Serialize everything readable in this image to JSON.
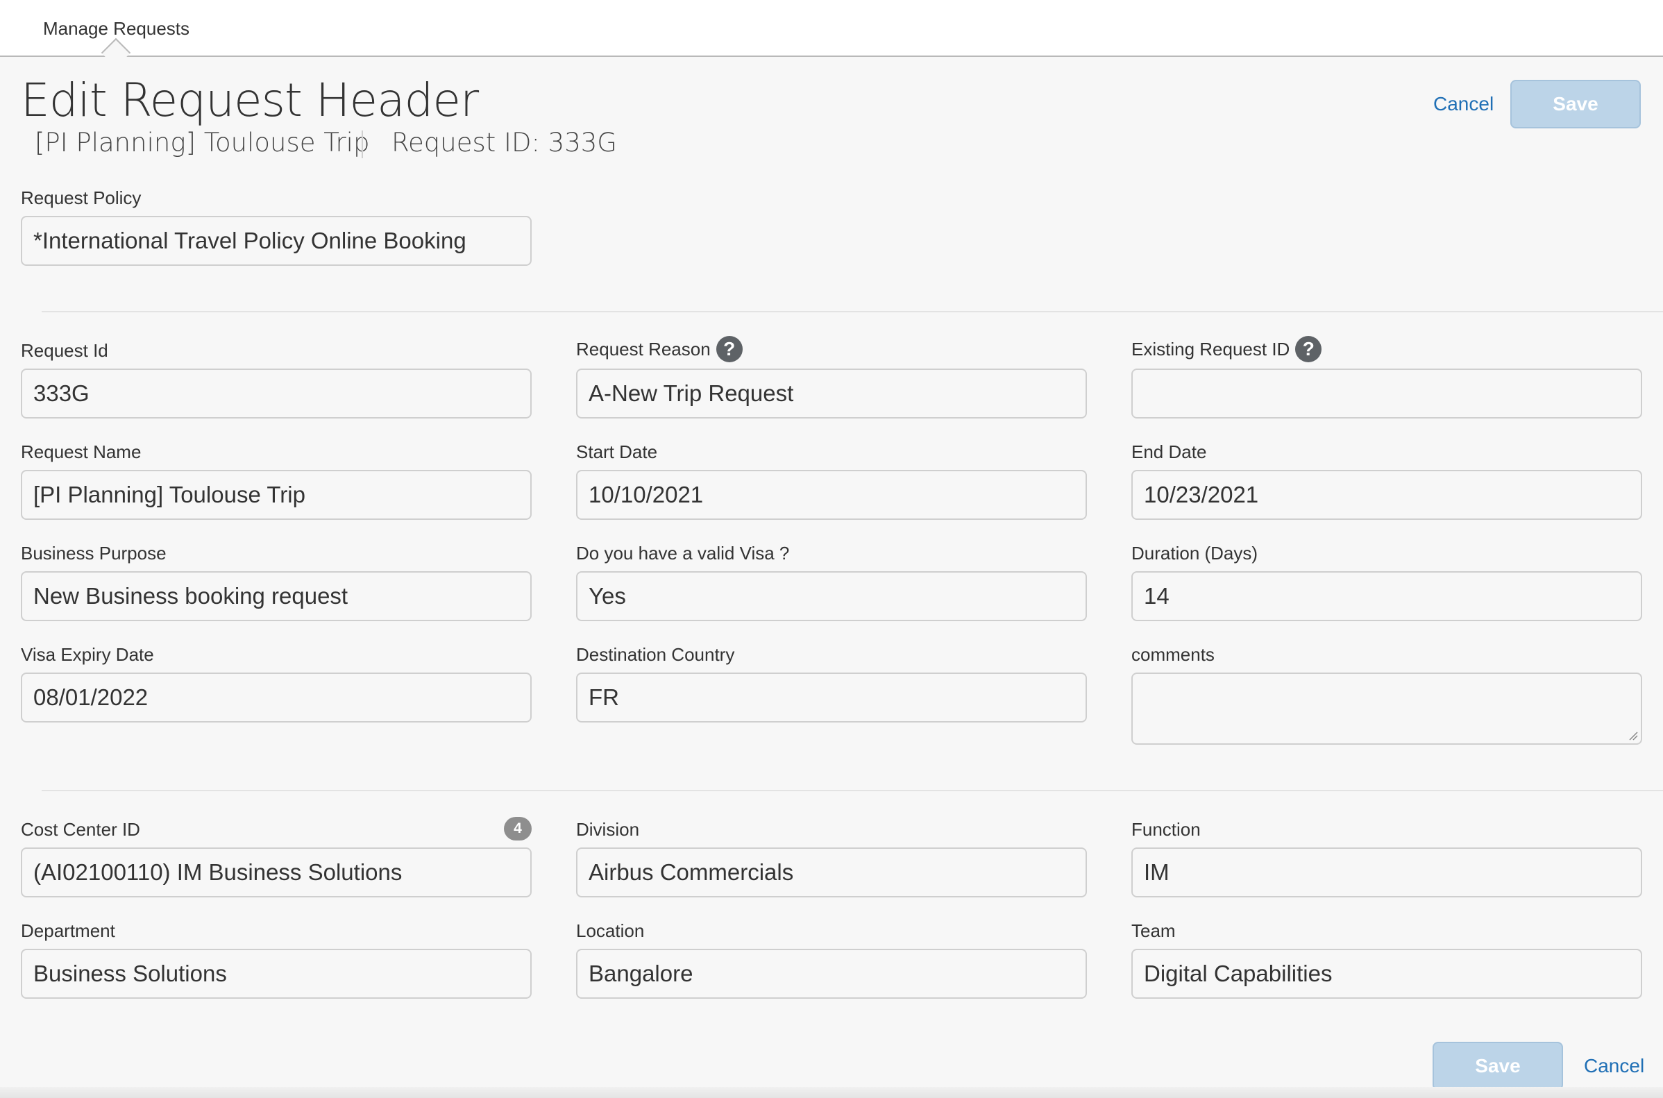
{
  "tabs": {
    "manage_requests": "Manage Requests"
  },
  "header": {
    "title": "Edit Request Header",
    "request_name": "[PI Planning] Toulouse Trip",
    "request_id_text": "Request ID: 333G",
    "cancel_label": "Cancel",
    "save_label": "Save"
  },
  "policy": {
    "label": "Request Policy",
    "value": "*International Travel Policy Online Booking"
  },
  "fields": {
    "request_id": {
      "label": "Request Id",
      "value": "333G"
    },
    "request_reason": {
      "label": "Request Reason",
      "value": "A-New Trip Request"
    },
    "existing_request_id": {
      "label": "Existing Request ID",
      "value": ""
    },
    "request_name": {
      "label": "Request Name",
      "value": "[PI Planning] Toulouse Trip"
    },
    "start_date": {
      "label": "Start Date",
      "value": "10/10/2021"
    },
    "end_date": {
      "label": "End Date",
      "value": "10/23/2021"
    },
    "business_purpose": {
      "label": "Business Purpose",
      "value": "New Business booking request"
    },
    "valid_visa": {
      "label": "Do you have a valid Visa ?",
      "value": "Yes"
    },
    "duration": {
      "label": "Duration (Days)",
      "value": "14"
    },
    "visa_expiry": {
      "label": "Visa Expiry Date",
      "value": "08/01/2022"
    },
    "destination_country": {
      "label": "Destination Country",
      "value": "FR"
    },
    "comments": {
      "label": "comments",
      "value": ""
    },
    "cost_center": {
      "label": "Cost Center ID",
      "value": "(AI02100110) IM Business Solutions",
      "badge": "4"
    },
    "division": {
      "label": "Division",
      "value": "Airbus Commercials"
    },
    "function": {
      "label": "Function",
      "value": "IM"
    },
    "department": {
      "label": "Department",
      "value": "Business Solutions"
    },
    "location": {
      "label": "Location",
      "value": "Bangalore"
    },
    "team": {
      "label": "Team",
      "value": "Digital Capabilities"
    }
  },
  "help_icon_glyph": "?",
  "footer": {
    "save_label": "Save",
    "cancel_label": "Cancel"
  }
}
